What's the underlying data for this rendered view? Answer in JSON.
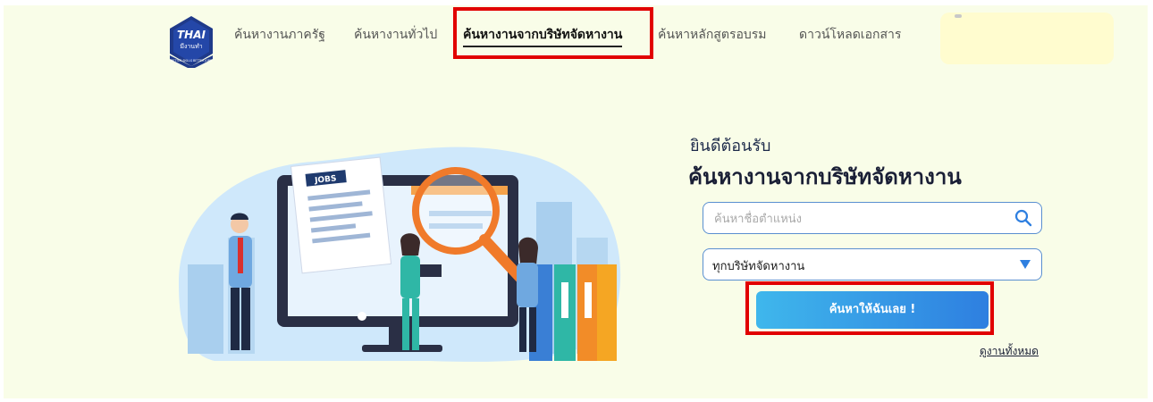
{
  "header": {
    "logo": {
      "brand_text": "THAI",
      "sub_text": "มีงานทำ",
      "ring_text": "BETTER SKILLS BETTER JOBS"
    },
    "nav": [
      {
        "label": "ค้นหางานภาครัฐ",
        "active": false
      },
      {
        "label": "ค้นหางานทั่วไป",
        "active": false
      },
      {
        "label": "ค้นหางานจากบริษัทจัดหางาน",
        "active": true
      },
      {
        "label": "ค้นหาหลักสูตรอบรม",
        "active": false
      },
      {
        "label": "ดาวน์โหลดเอกสาร",
        "active": false
      }
    ]
  },
  "illustration": {
    "jobs_tag": "JOBS",
    "icon": "job-search-illustration"
  },
  "search": {
    "welcome": "ยินดีต้อนรับ",
    "title": "ค้นหางานจากบริษัทจัดหางาน",
    "position_placeholder": "ค้นหาชื่อตำแหน่ง",
    "position_value": "",
    "company_selected": "ทุกบริษัทจัดหางาน",
    "submit_label": "ค้นหาให้ฉันเลย !",
    "view_all_label": "ดูงานทั้งหมด"
  },
  "colors": {
    "page_bg": "#f9fde8",
    "highlight": "#e10000",
    "button_start": "#3fb7ec",
    "button_end": "#2e7fe0",
    "field_border": "#5a8fd0",
    "logo_blue": "#1f3a8a",
    "user_box_bg": "#fffccf"
  }
}
